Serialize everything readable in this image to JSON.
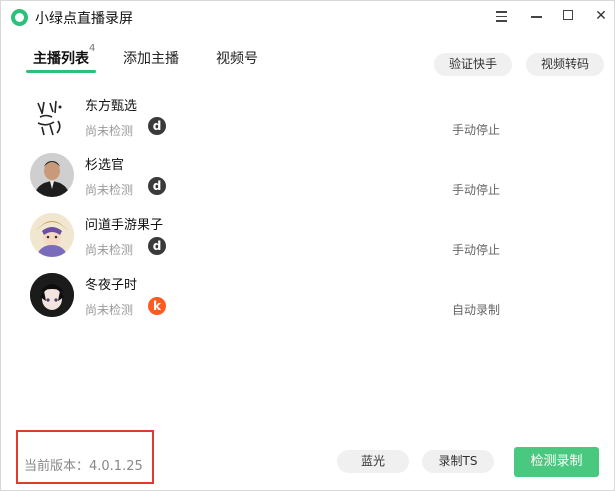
{
  "window": {
    "title": "小绿点直播录屏",
    "accent_color": "#2cc07a"
  },
  "tabs": [
    {
      "label": "主播列表",
      "badge": "4",
      "active": true
    },
    {
      "label": "添加主播",
      "active": false
    },
    {
      "label": "视频号",
      "active": false
    }
  ],
  "toolbar": {
    "verify_label": "验证快手",
    "transcode_label": "视频转码"
  },
  "streamers": [
    {
      "name": "东方甄选",
      "status": "尚未检测",
      "platform": "d",
      "platform_color": "#3a3a3a",
      "mode": "手动停止"
    },
    {
      "name": "杉选官",
      "status": "尚未检测",
      "platform": "d",
      "platform_color": "#3a3a3a",
      "mode": "手动停止"
    },
    {
      "name": "问道手游果子",
      "status": "尚未检测",
      "platform": "d",
      "platform_color": "#3a3a3a",
      "mode": "手动停止"
    },
    {
      "name": "冬夜子时",
      "status": "尚未检测",
      "platform": "k",
      "platform_color": "#ff5a1f",
      "mode": "自动录制"
    }
  ],
  "footer": {
    "version_text": "当前版本：4.0.1.25",
    "bluray_label": "蓝光",
    "ts_label": "录制TS",
    "detect_label": "检测录制"
  }
}
